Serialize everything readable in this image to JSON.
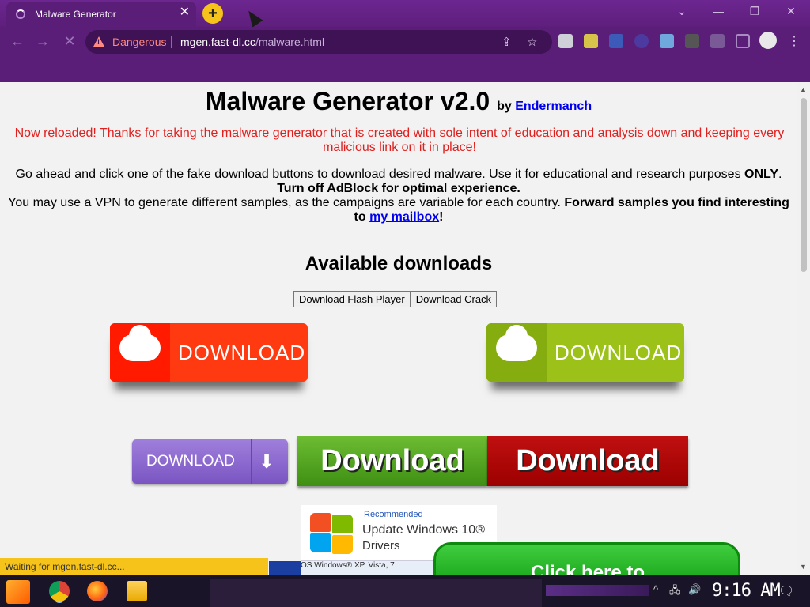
{
  "browser": {
    "tab_title": "Malware Generator",
    "tab_close": "✕",
    "new_tab": "+",
    "window_controls": [
      "⌄",
      "—",
      "❐",
      "✕"
    ],
    "nav": {
      "back": "←",
      "forward": "→",
      "reload": "✕"
    },
    "security_label": "Dangerous",
    "url_host": "mgen.fast-dl.cc",
    "url_path": "/malware.html",
    "omnibox_icons": [
      "share-icon",
      "star-icon"
    ],
    "extension_icons": [
      "ext-icon-1",
      "ext-icon-2",
      "ext-icon-3",
      "ext-icon-4",
      "ext-icon-5",
      "ext-icon-6",
      "puzzle-icon",
      "sidepanel-icon"
    ],
    "menu": "⋮"
  },
  "page": {
    "title": "Malware Generator v2.0",
    "by": "by",
    "author": "Endermanch",
    "notice": "Now reloaded! Thanks for taking the malware generator that is created with sole intent of education and analysis down and keeping every malicious link on it in place!",
    "intro_1": "Go ahead and click one of the fake download buttons to download desired malware. Use it for educational and research purposes",
    "intro_only": "ONLY",
    "intro_adblock": "Turn off AdBlock for optimal experience.",
    "intro_2": "You may use a VPN to generate different samples, as the campaigns are variable for each country.",
    "intro_forward": "Forward samples you find interesting to",
    "mailbox_link": "my mailbox",
    "exclaim": "!",
    "downloads_heading": "Available downloads",
    "buttons": {
      "flash": "Download Flash Player",
      "crack": "Download Crack"
    },
    "download_tiles": {
      "red": "DOWNLOAD",
      "lime": "DOWNLOAD",
      "purple": "DOWNLOAD",
      "purple_arrow": "⬇",
      "green": "Download",
      "darkred": "Download"
    },
    "ad_windows": {
      "recommended": "Recommended",
      "line1": "Update Windows 10®",
      "line2": "Drivers",
      "strip": "OS   Windows® XP, Vista, 7"
    },
    "ad_click": "Click here to"
  },
  "status_bar": "Waiting for mgen.fast-dl.cc...",
  "taskbar": {
    "apps": [
      "start-icon",
      "chrome-icon",
      "firefox-icon",
      "file-explorer-icon"
    ],
    "tray": [
      "^",
      "🖧",
      "🔊"
    ],
    "clock": "9:16 AM",
    "notifications": "🗨"
  },
  "colors": {
    "browser_purple": "#5b1e78",
    "danger": "#ff8a80",
    "notice_red": "#e0201e",
    "link": "#0000ee",
    "status_yellow": "#f6c31a"
  }
}
